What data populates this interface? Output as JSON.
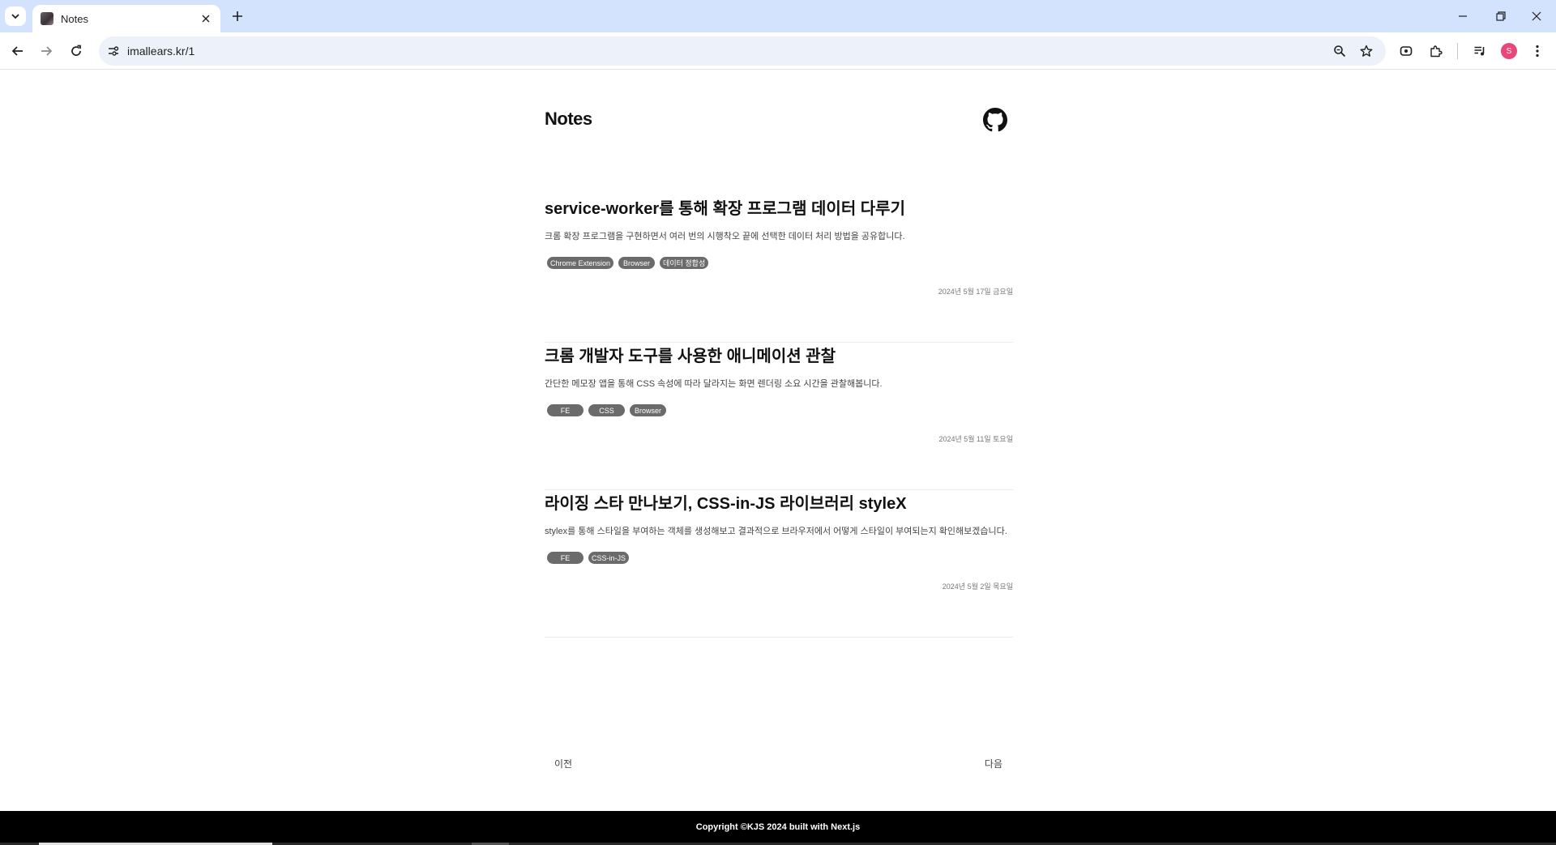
{
  "browser": {
    "tab_title": "Notes",
    "url": "imallears.kr/1",
    "profile_initial": "S",
    "icons": [
      "tab-list-icon",
      "favicon-icon",
      "close-icon",
      "plus-icon",
      "minimize-icon",
      "restore-icon",
      "window-close-icon",
      "back-arrow-icon",
      "forward-arrow-icon",
      "reload-icon",
      "site-info-icon",
      "zoom-icon",
      "star-icon",
      "screencast-icon",
      "extensions-icon",
      "media-controls-icon",
      "kebab-menu-icon"
    ]
  },
  "site": {
    "title": "Notes",
    "github_icon": "github-icon"
  },
  "posts": [
    {
      "title": "service-worker를 통해 확장 프로그램 데이터 다루기",
      "description": "크롬 확장 프로그램을 구현하면서 여러 번의 시행착오 끝에 선택한 데이터 처리 방법을 공유합니다.",
      "tags": [
        "Chrome Extension",
        "Browser",
        "데이터 정합성"
      ],
      "date": "2024년 5월 17일 금요일"
    },
    {
      "title": "크롬 개발자 도구를 사용한 애니메이션 관찰",
      "description": "간단한 메모장 앱을 통해 CSS 속성에 따라 달라지는 화면 렌더링 소요 시간을 관찰해봅니다.",
      "tags": [
        "FE",
        "CSS",
        "Browser"
      ],
      "date": "2024년 5월 11일 토요일"
    },
    {
      "title": "라이징 스타 만나보기, CSS-in-JS 라이브러리 styleX",
      "description": "stylex를 통해 스타일을 부여하는 객체를 생성해보고 결과적으로 브라우저에서 어떻게 스타일이 부여되는지 확인해보겠습니다.",
      "tags": [
        "FE",
        "CSS-in-JS"
      ],
      "date": "2024년 5월 2일 목요일"
    }
  ],
  "pager": {
    "prev": "이전",
    "next": "다음"
  },
  "footer": {
    "text": "Copyright ©KJS 2024 built with Next.js"
  },
  "colors": {
    "tabbar": "#d3e3fd",
    "omnibox": "#edf2fa",
    "tag_bg": "#6b6b6b",
    "footer_bg": "#000000",
    "profile": "#e8477a"
  }
}
